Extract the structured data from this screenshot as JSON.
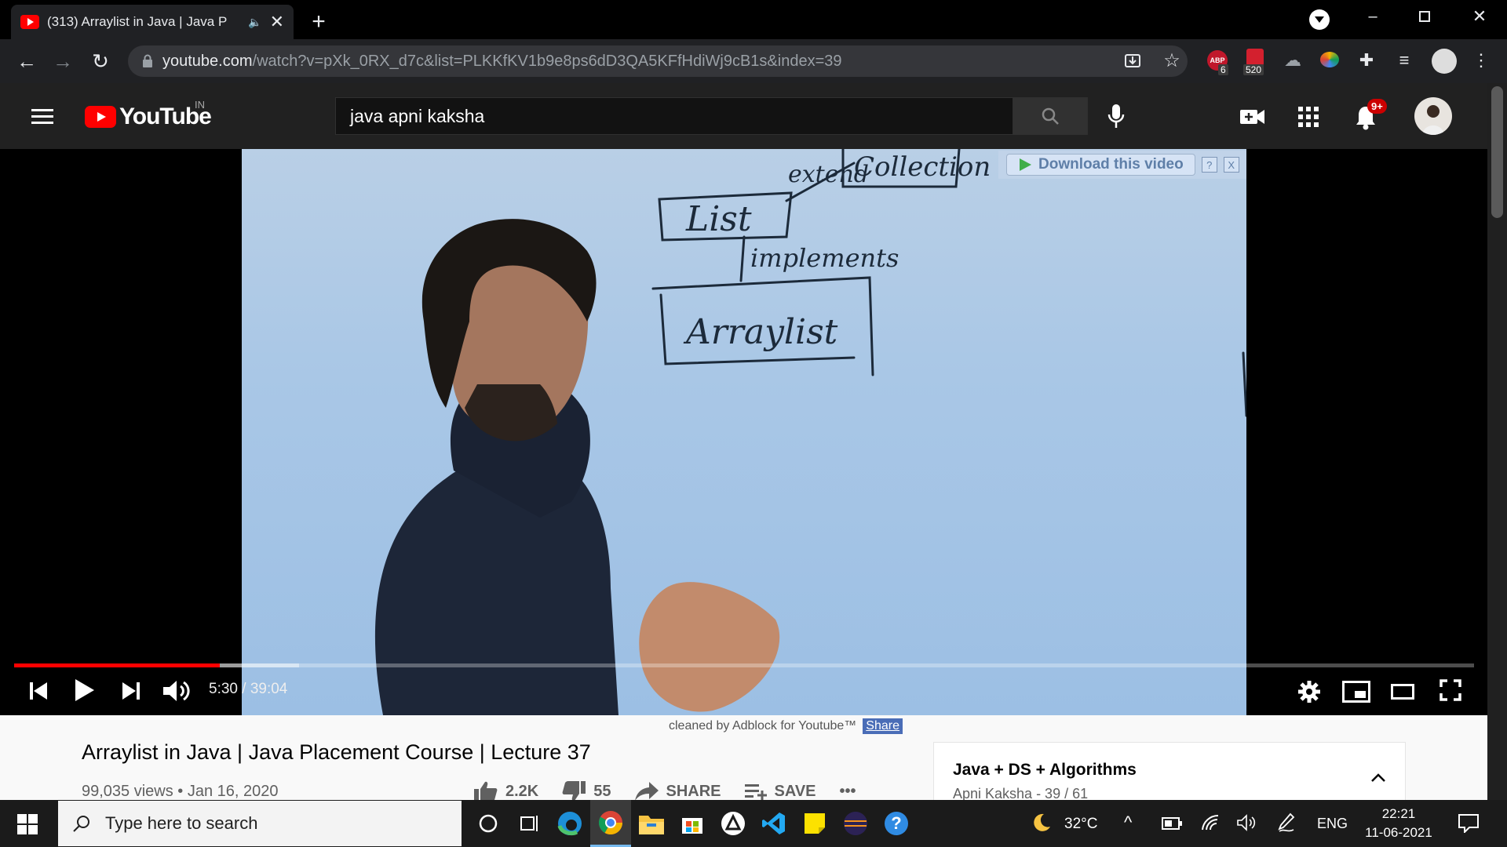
{
  "browser": {
    "tab_title": "(313) Arraylist in Java | Java P",
    "url_host": "youtube.com",
    "url_path": "/watch?v=pXk_0RX_d7c&list=PLKKfKV1b9e8ps6dD3QA5KFfHdiWj9cB1s&index=39",
    "ext_abp_count": "6",
    "ext_counter_520": "520",
    "ext_abp_label": "ABP"
  },
  "youtube": {
    "logo_text": "YouTube",
    "country_code": "IN",
    "search_value": "java apni kaksha",
    "notification_badge": "9+"
  },
  "video": {
    "board_text_extends": "extend",
    "board_text_collection": "Collection",
    "board_text_list": "List",
    "board_text_implements": "implements",
    "board_text_arraylist": "Arraylist",
    "download_label": "Download this video",
    "download_help": "?",
    "download_close": "X",
    "current_time": "5:30 / 39:04",
    "progress_fraction": 0.141,
    "buffered_fraction": 0.195
  },
  "below_video": {
    "adblock_text": "cleaned by Adblock for Youtube™",
    "adblock_share": "Share",
    "title": "Arraylist in Java | Java Placement Course | Lecture 37",
    "views_date": "99,035 views • Jan 16, 2020",
    "likes": "2.2K",
    "dislikes": "55",
    "share_label": "SHARE",
    "save_label": "SAVE",
    "more_label": "•••",
    "playlist_title": "Java + DS + Algorithms",
    "playlist_sub": "Apni Kaksha - 39 / 61"
  },
  "taskbar": {
    "search_placeholder": "Type here to search",
    "weather": "32°C",
    "language": "ENG",
    "time": "22:21",
    "date": "11-06-2021"
  },
  "colors": {
    "youtube_red": "#ff0000",
    "progress_red": "#ff0000",
    "chrome_dark": "#202124"
  }
}
